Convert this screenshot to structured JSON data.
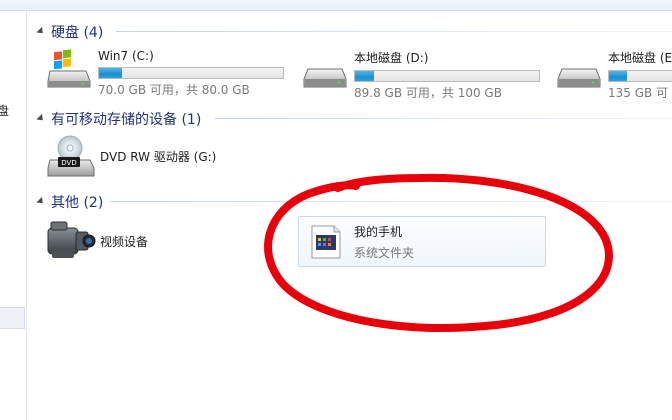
{
  "nav": {
    "partial_label": "盘"
  },
  "groups": {
    "hard_disks": {
      "title": "硬盘 (4)",
      "drives": [
        {
          "name": "Win7 (C:)",
          "info": "70.0 GB 可用，共 80.0 GB",
          "used_fraction": 0.125
        },
        {
          "name": "本地磁盘 (D:)",
          "info": "89.8 GB 可用，共 100 GB",
          "used_fraction": 0.102
        },
        {
          "name": "本地磁盘 (E",
          "info": "135 GB 可",
          "used_fraction": 0.1
        }
      ]
    },
    "removable": {
      "title": "有可移动存储的设备 (1)",
      "devices": [
        {
          "name": "DVD RW 驱动器 (G:)",
          "badge": "DVD"
        }
      ]
    },
    "other": {
      "title": "其他 (2)",
      "devices": [
        {
          "name": "视频设备"
        },
        {
          "name": "我的手机",
          "subtitle": "系统文件夹"
        }
      ]
    }
  },
  "colors": {
    "annotation": "#e8000a",
    "group_header": "#1e3287",
    "bar_fill": "#1b8fd2"
  }
}
